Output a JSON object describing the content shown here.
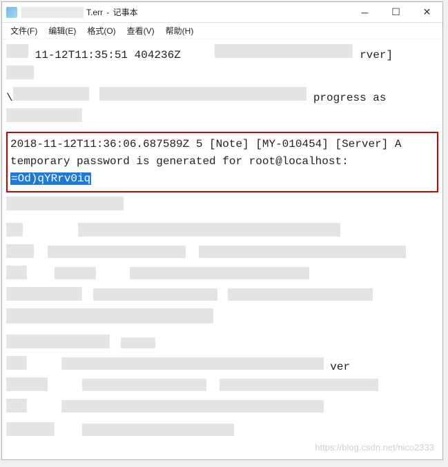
{
  "titlebar": {
    "filename_visible": "T.err",
    "app_name": "记事本"
  },
  "menu": {
    "file": "文件(F)",
    "edit": "编辑(E)",
    "format": "格式(O)",
    "view": "查看(V)",
    "help": "帮助(H)"
  },
  "log": {
    "pre_fragment_1": "11-12T11:35:51 404236Z",
    "pre_fragment_2": "rver]",
    "pre_fragment_3": "progress as",
    "highlighted_line1": "2018-11-12T11:36:06.687589Z 5 [Note] [MY-010454] [Server] A",
    "highlighted_line2": "temporary password is generated for root@localhost:",
    "highlighted_password": "=Od)qYRrv0iq",
    "post_fragment_1": "ver"
  },
  "watermark": "https://blog.csdn.net/nico2333"
}
